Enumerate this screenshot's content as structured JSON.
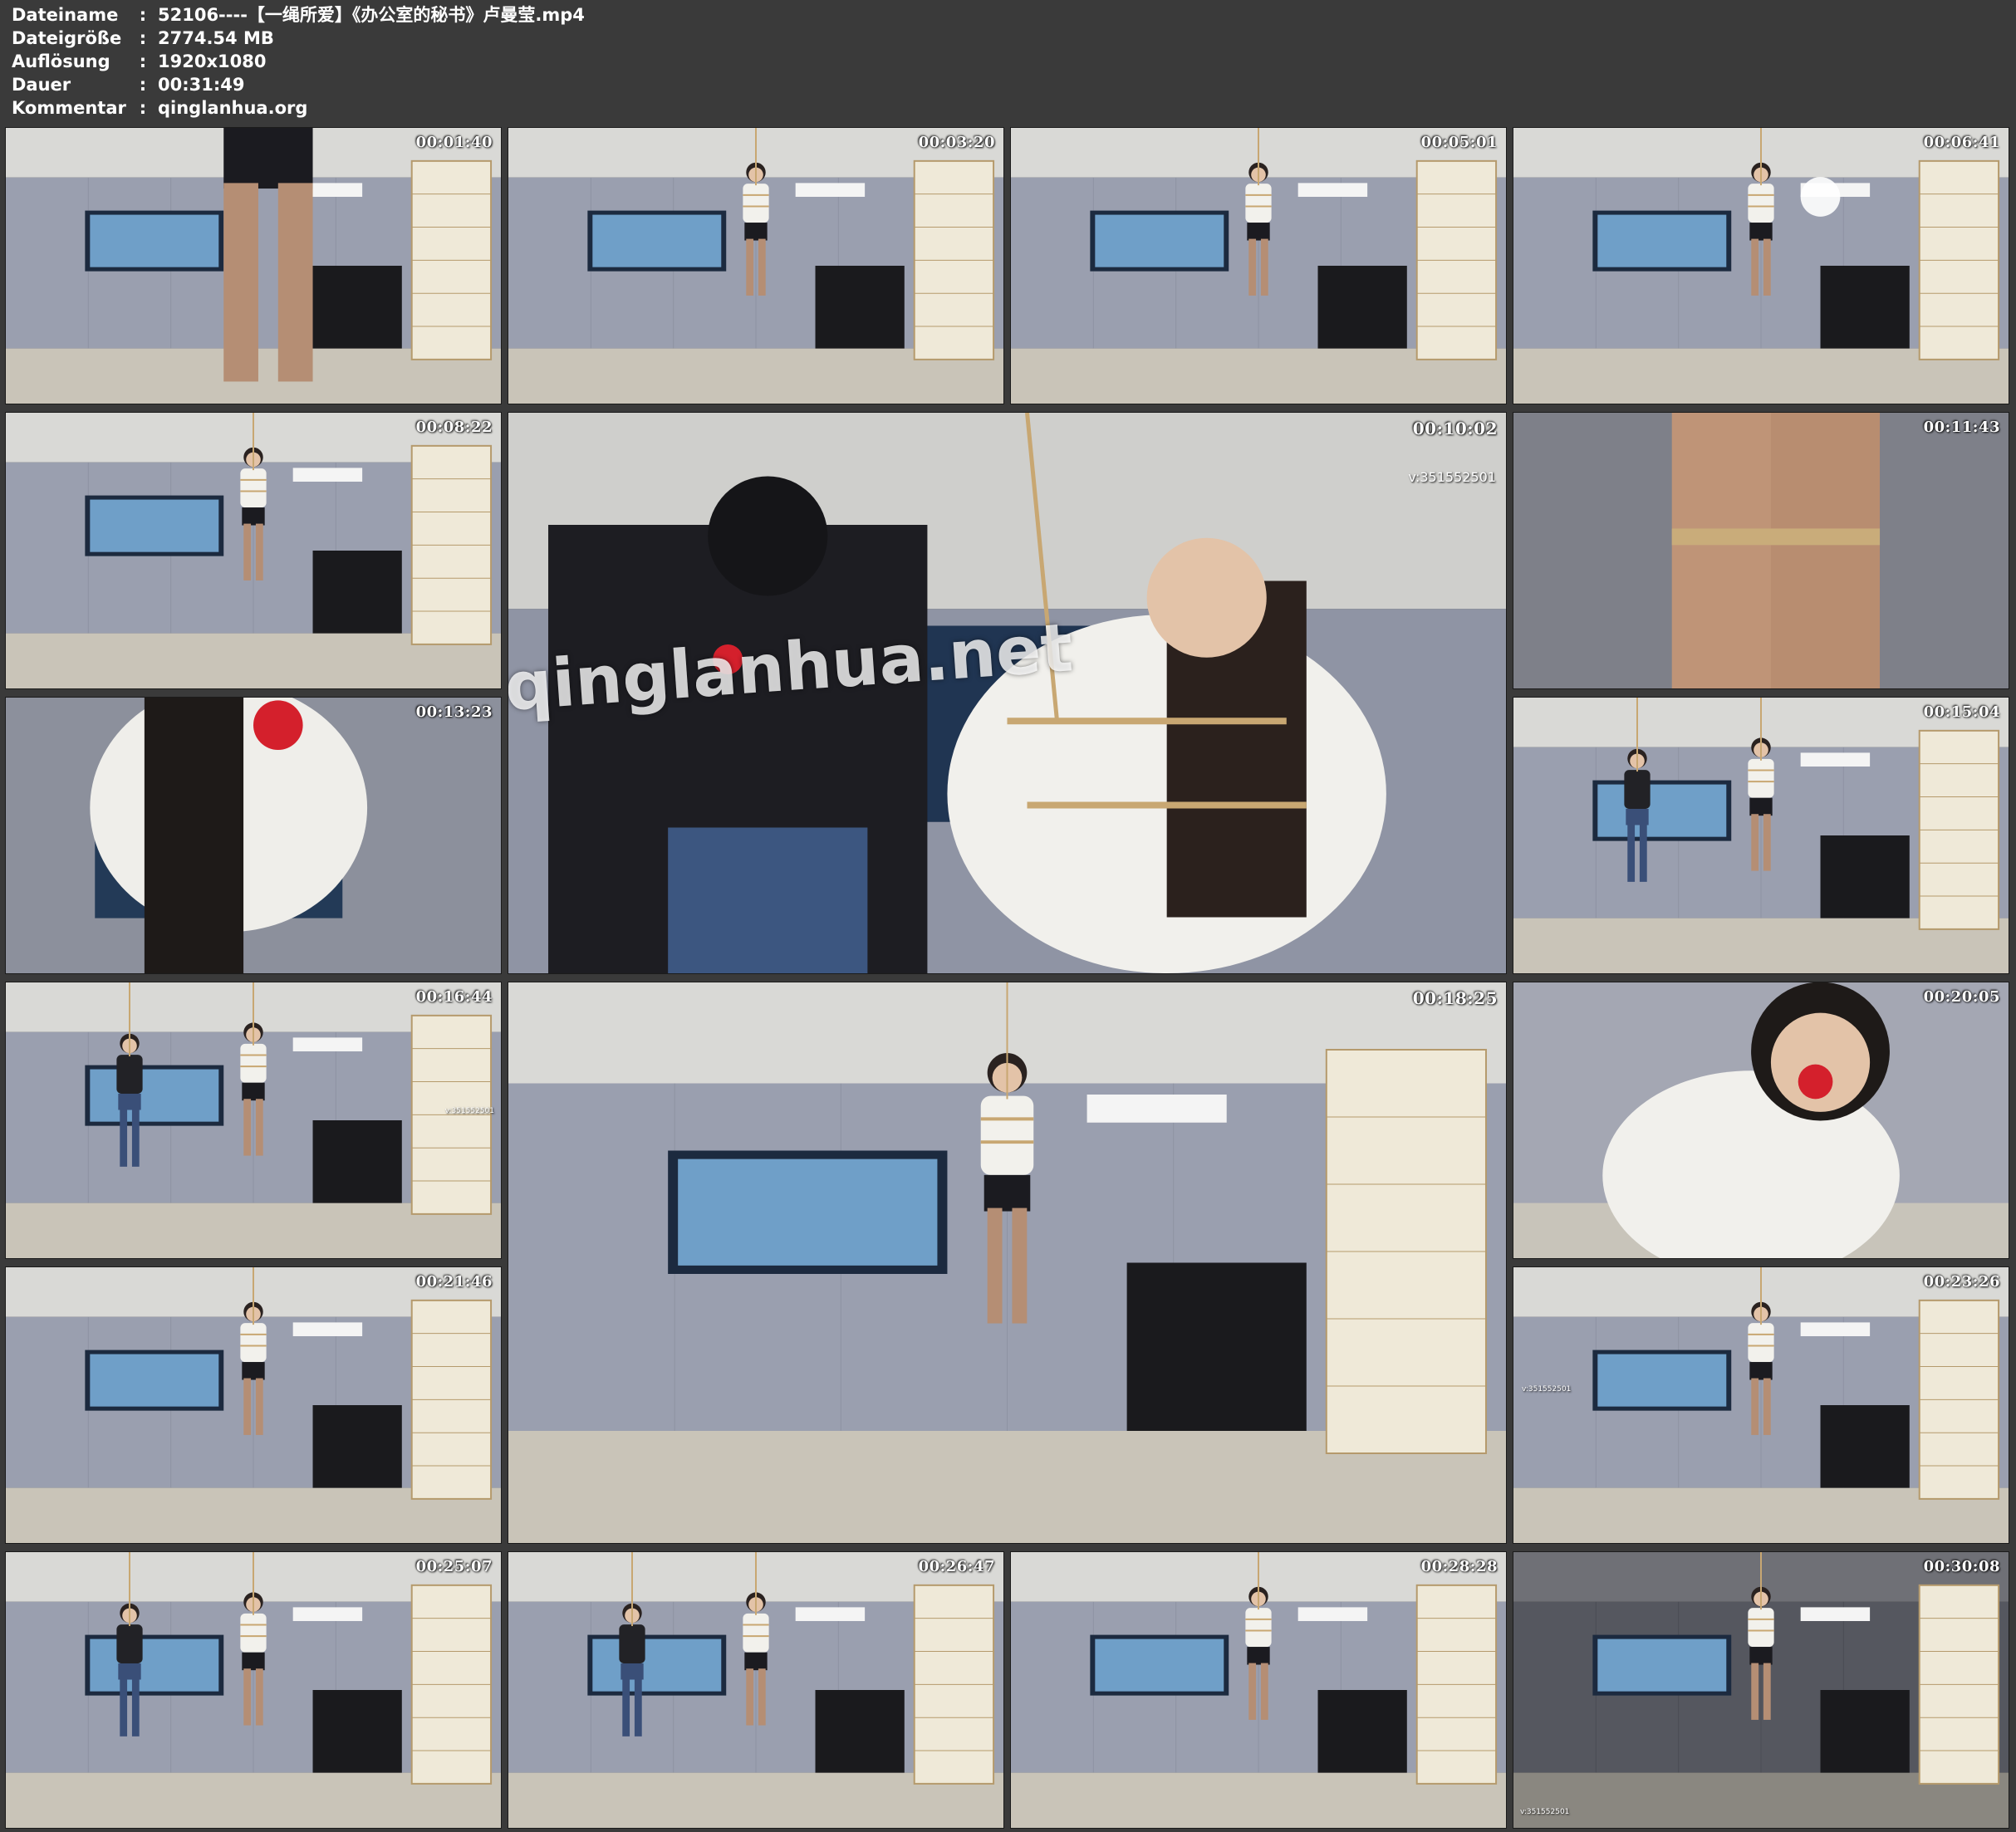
{
  "info": [
    {
      "key": "Dateiname",
      "sep": ":",
      "value": "52106----【一绳所爱】《办公室的秘书》卢曼莹.mp4"
    },
    {
      "key": "Dateigröße",
      "sep": ":",
      "value": "2774.54 MB"
    },
    {
      "key": "Auflösung",
      "sep": ":",
      "value": "1920x1080"
    },
    {
      "key": "Dauer",
      "sep": ":",
      "value": "00:31:49"
    },
    {
      "key": "Kommentar",
      "sep": ":",
      "value": "qinglanhua.org"
    }
  ],
  "thumbnails": [
    {
      "timestamp": "00:01:40",
      "scene": "legs"
    },
    {
      "timestamp": "00:03:20",
      "scene": "room-far"
    },
    {
      "timestamp": "00:05:01",
      "scene": "room-screen"
    },
    {
      "timestamp": "00:06:41",
      "scene": "room-light"
    },
    {
      "timestamp": "00:08:22",
      "scene": "room-screen"
    },
    {
      "timestamp": "00:10:02",
      "scene": "closeup-two",
      "overlay": "v:351552501",
      "watermark": "qinglanhua.net"
    },
    {
      "timestamp": "00:11:43",
      "scene": "knees"
    },
    {
      "timestamp": "00:13:23",
      "scene": "hair-close"
    },
    {
      "timestamp": "00:15:04",
      "scene": "room-two"
    },
    {
      "timestamp": "00:16:44",
      "scene": "room-two",
      "overlay": "v:351552501"
    },
    {
      "timestamp": "00:18:25",
      "scene": "room-far"
    },
    {
      "timestamp": "00:20:05",
      "scene": "face-close"
    },
    {
      "timestamp": "00:21:46",
      "scene": "room-far"
    },
    {
      "timestamp": "00:23:26",
      "scene": "room-far",
      "overlay": "v:351552501"
    },
    {
      "timestamp": "00:25:07",
      "scene": "room-two"
    },
    {
      "timestamp": "00:26:47",
      "scene": "room-two"
    },
    {
      "timestamp": "00:28:28",
      "scene": "room-far"
    },
    {
      "timestamp": "00:30:08",
      "scene": "room-dark",
      "overlay": "v:351552501"
    }
  ]
}
